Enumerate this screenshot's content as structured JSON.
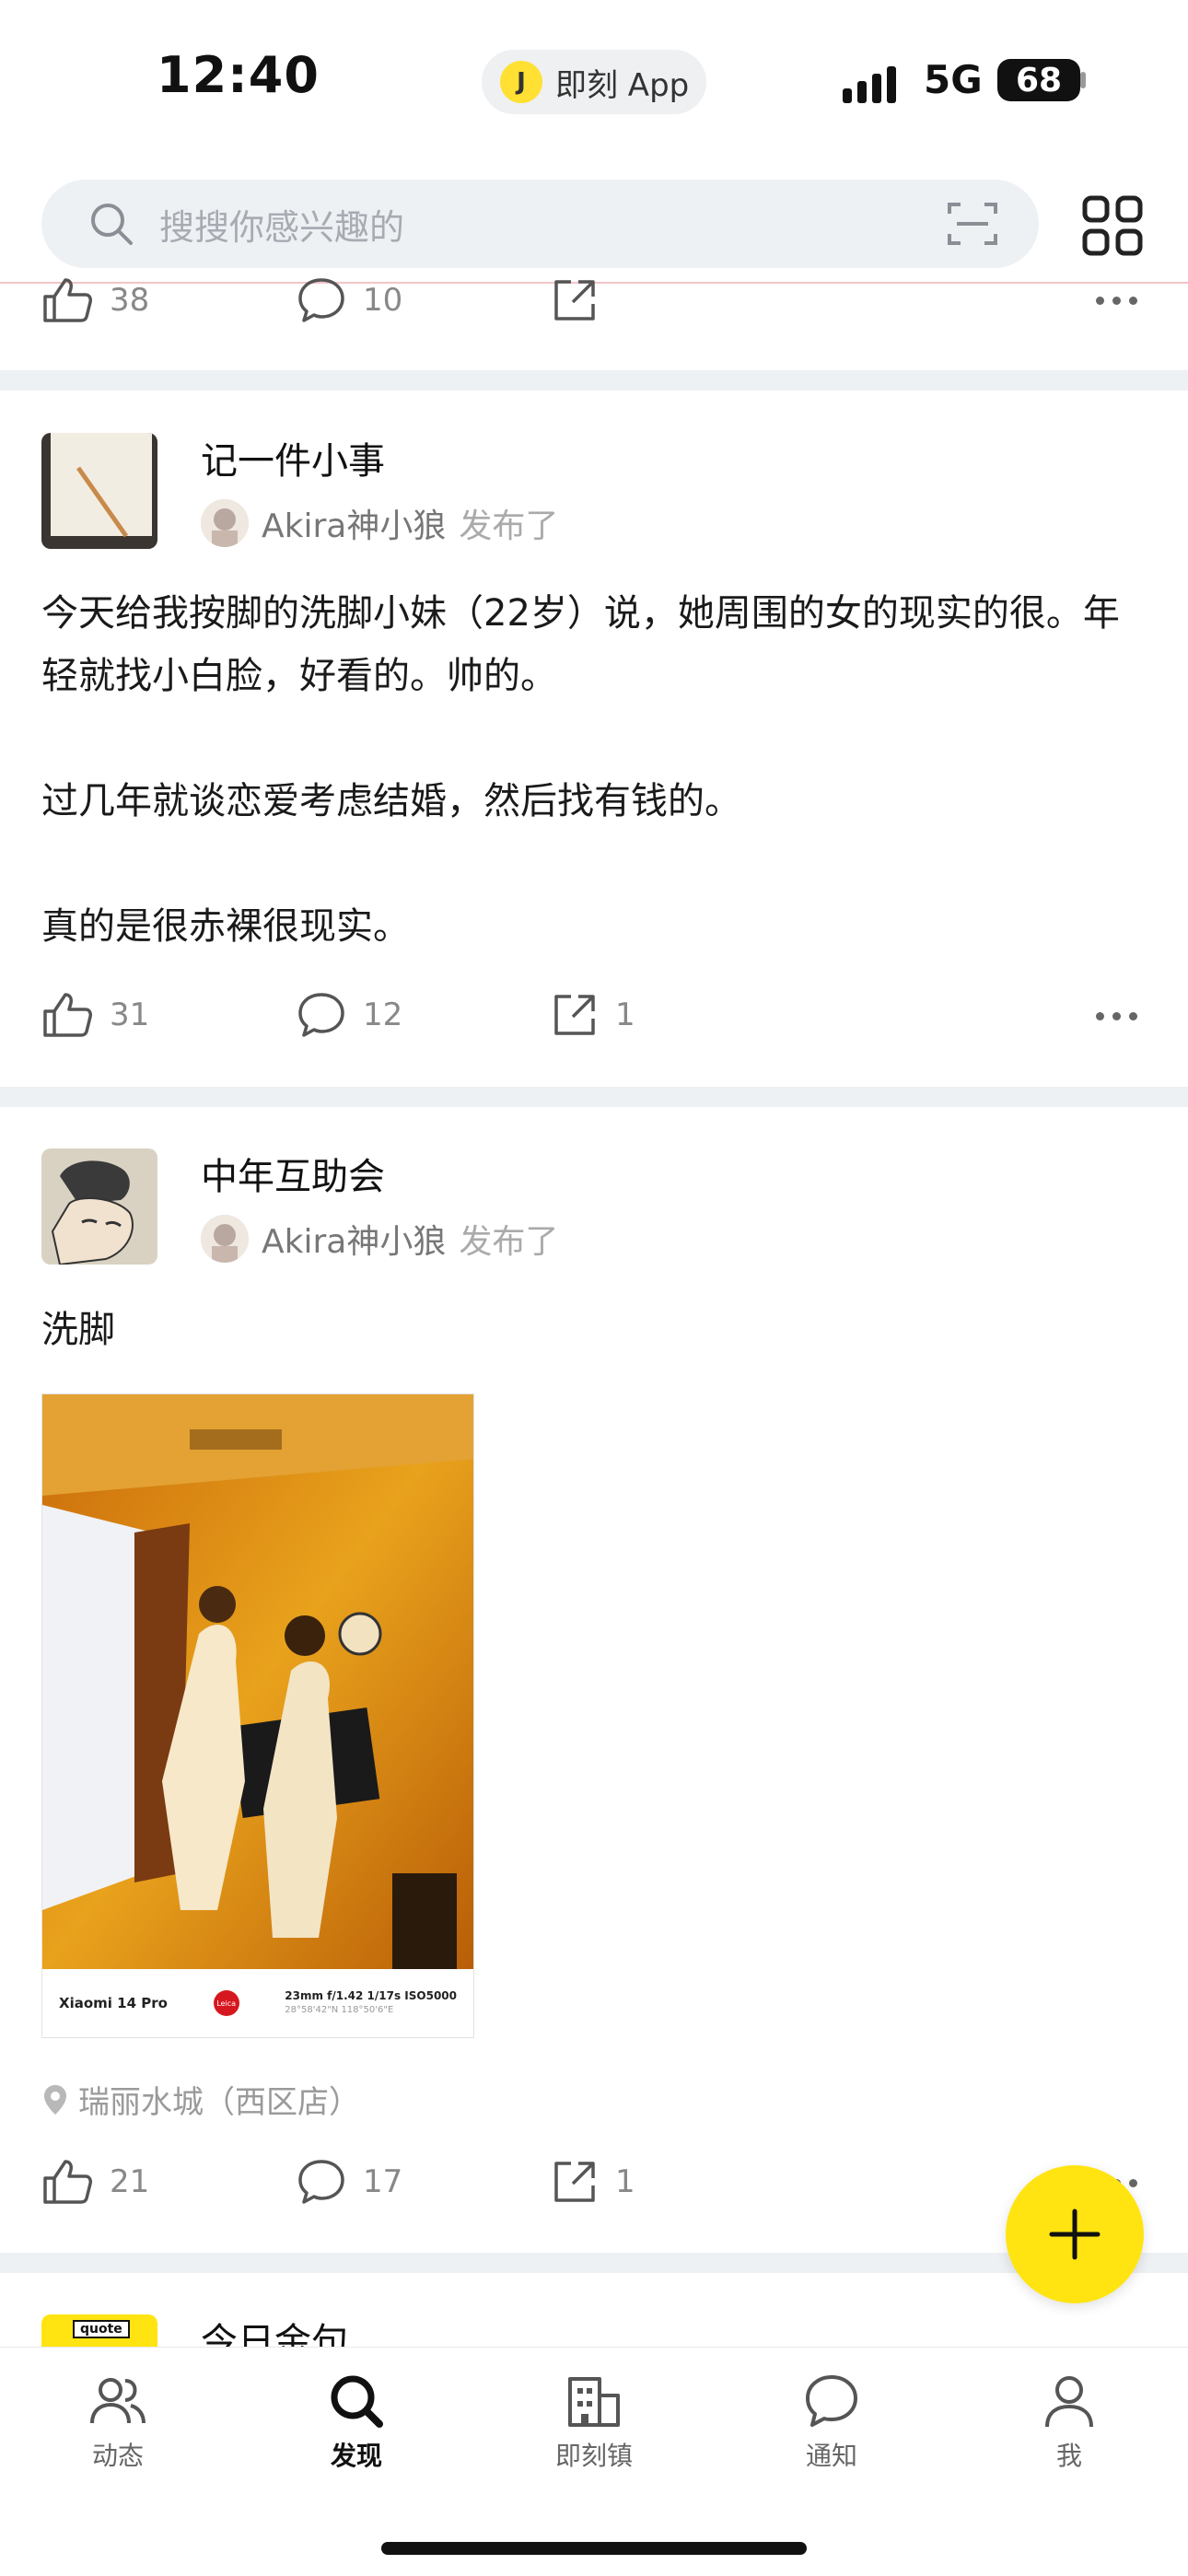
{
  "status_bar": {
    "time": "12:40",
    "island_logo": "J",
    "island_text": "即刻 App",
    "network": "5G",
    "battery": "68"
  },
  "search": {
    "placeholder": "搜搜你感兴趣的"
  },
  "posts": [
    {
      "likes": "38",
      "comments": "10",
      "shares": ""
    },
    {
      "topic": "记一件小事",
      "author": "Akira神小狼",
      "action": "发布了",
      "paragraphs": [
        "今天给我按脚的洗脚小妹（22岁）说，她周围的女的现实的很。年轻就找小白脸，好看的。帅的。",
        "过几年就谈恋爱考虑结婚，然后找有钱的。",
        "真的是很赤裸很现实。"
      ],
      "likes": "31",
      "comments": "12",
      "shares": "1"
    },
    {
      "topic": "中年互助会",
      "author": "Akira神小狼",
      "action": "发布了",
      "text": "洗脚",
      "photo_watermark": {
        "brand": "Xiaomi 14 Pro",
        "logo": "Leica",
        "specs": "23mm  f/1.42  1/17s  ISO5000",
        "coords": "28°58'42\"N  118°50'6\"E"
      },
      "location": "瑞丽水城（西区店）",
      "likes": "21",
      "comments": "17",
      "shares": "1"
    },
    {
      "topic": "今日金句",
      "avatar_label": "quote"
    }
  ],
  "bottom_nav": [
    {
      "label": "动态",
      "icon": "people-icon",
      "active": false
    },
    {
      "label": "发现",
      "icon": "search-icon",
      "active": true
    },
    {
      "label": "即刻镇",
      "icon": "building-icon",
      "active": false
    },
    {
      "label": "通知",
      "icon": "chat-bubble-icon",
      "active": false
    },
    {
      "label": "我",
      "icon": "person-icon",
      "active": false
    }
  ],
  "colors": {
    "accent": "#ffe411",
    "divider": "#eef1f4"
  }
}
